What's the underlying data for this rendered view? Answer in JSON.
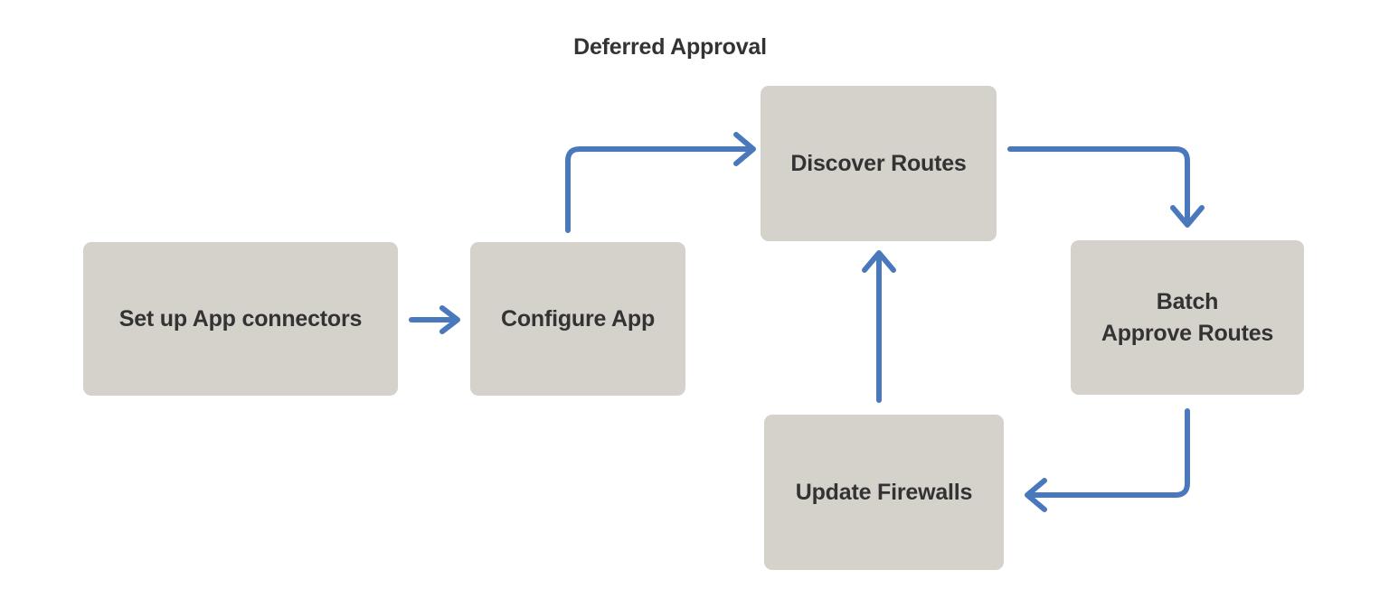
{
  "diagram": {
    "title": "Deferred Approval",
    "colors": {
      "background": "#ffffff",
      "node_fill": "#d5d2cc",
      "node_text": "#333333",
      "edge": "#4a78bd",
      "title_text": "#333333"
    },
    "nodes": [
      {
        "id": "setup",
        "label": "Set up App connectors"
      },
      {
        "id": "configure",
        "label": "Configure App"
      },
      {
        "id": "discover",
        "label": "Discover Routes"
      },
      {
        "id": "batch",
        "label": "Batch\nApprove Routes"
      },
      {
        "id": "firewalls",
        "label": "Update Firewalls"
      }
    ],
    "edges": [
      {
        "id": "setup-to-configure",
        "from": "setup",
        "to": "configure",
        "style": "straight-right"
      },
      {
        "id": "configure-to-discover",
        "from": "configure",
        "to": "discover",
        "style": "elbow-up-right"
      },
      {
        "id": "discover-to-batch",
        "from": "discover",
        "to": "batch",
        "style": "elbow-right-down"
      },
      {
        "id": "batch-to-firewalls",
        "from": "batch",
        "to": "firewalls",
        "style": "elbow-down-left"
      },
      {
        "id": "firewalls-to-discover",
        "from": "firewalls",
        "to": "discover",
        "style": "straight-up"
      }
    ]
  }
}
